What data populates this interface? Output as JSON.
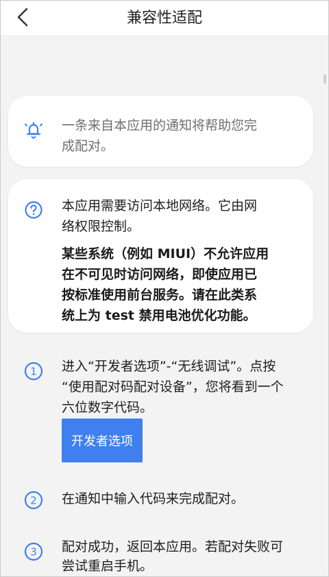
{
  "header": {
    "title": "兼容性适配"
  },
  "notice_card": {
    "text_line1": "一条来自本应用的通知将帮助您完",
    "text_line2": "成配对。"
  },
  "info_card": {
    "line1": "本应用需要访问本地网络。它由网",
    "line2": "络权限控制。",
    "bold_line1": "某些系统（例如 MIUI）不允许应用",
    "bold_line2": "在不可见时访问网络，即使应用已",
    "bold_line3": "按标准使用前台服务。请在此类系",
    "bold_line4": "统上为 test 禁用电池优化功能。"
  },
  "steps": [
    {
      "number": "1",
      "line1": "进入“开发者选项”-“无线调试”。点按",
      "line2": "“使用配对码配对设备”，您将看到一个",
      "line3": "六位数字代码。"
    },
    {
      "number": "2",
      "line1": "在通知中输入代码来完成配对。"
    },
    {
      "number": "3",
      "line1": "配对成功，返回本应用。若配对失败可",
      "line2": "尝试重启手机。"
    }
  ],
  "developer_button": {
    "label": "开发者选项"
  },
  "colors": {
    "accent": "#3f80ee",
    "background": "#f3f3f3",
    "card": "#ffffff"
  },
  "icons": [
    "back-arrow-icon",
    "bell-icon",
    "help-circle-icon",
    "number-1-icon",
    "number-2-icon",
    "number-3-icon"
  ]
}
